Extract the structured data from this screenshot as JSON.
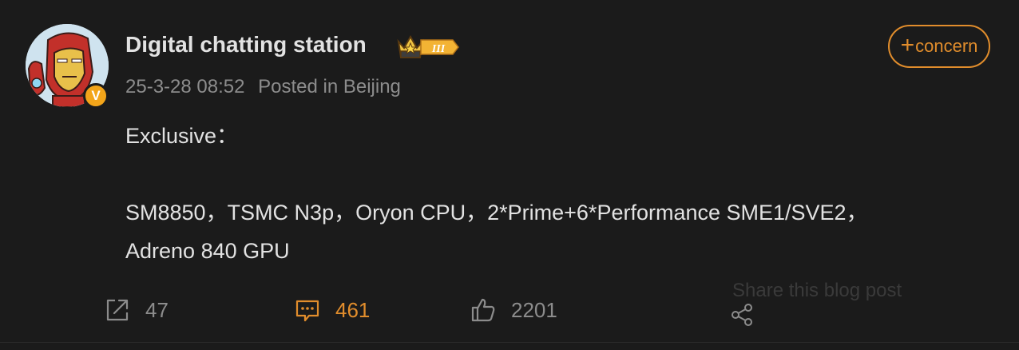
{
  "post": {
    "author": {
      "name": "Digital chatting station",
      "verified_badge": "V",
      "rank_badge": "III"
    },
    "timestamp": "25-3-28 08:52",
    "location": "Posted in Beijing",
    "follow_label": "concern",
    "follow_plus": "+",
    "content": {
      "line1": "Exclusive：",
      "line2": "SM8850，TSMC N3p，Oryon CPU，2*Prime+6*Performance SME1/SVE2，",
      "line3": "Adreno 840 GPU"
    },
    "actions": {
      "repost_count": "47",
      "comment_count": "461",
      "like_count": "2201",
      "share_tooltip": "Share this blog post"
    }
  },
  "colors": {
    "background": "#1b1b1b",
    "accent": "#e18d2c",
    "text_primary": "#e2e2e2",
    "text_secondary": "#8c8c8c",
    "badge_gold": "#f3a51a"
  },
  "icons": {
    "repost": "repost-icon",
    "comment": "comment-icon",
    "like": "thumbs-up-icon",
    "share": "share-icon",
    "rank": "crown-icon"
  }
}
